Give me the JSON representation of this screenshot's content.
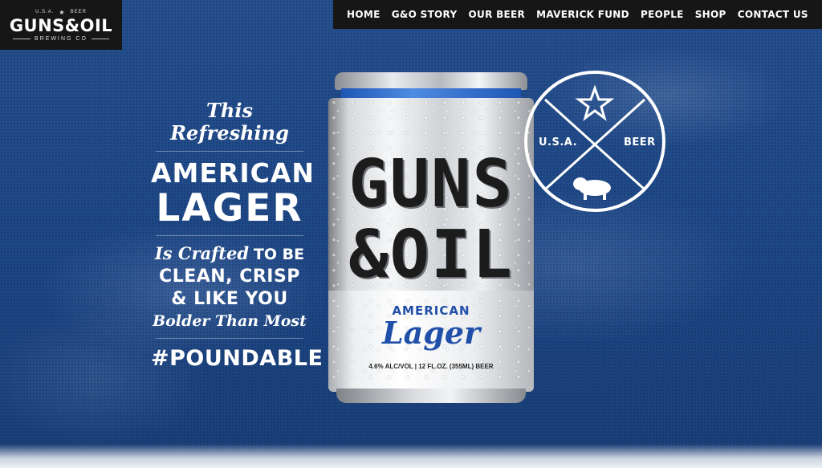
{
  "brand": {
    "mini_left": "U.S.A.",
    "mini_right": "BEER",
    "name": "GUNS&OIL",
    "tagline": "BREWING CO"
  },
  "nav": {
    "items": [
      {
        "label": "HOME"
      },
      {
        "label": "G&O STORY"
      },
      {
        "label": "OUR BEER"
      },
      {
        "label": "MAVERICK FUND"
      },
      {
        "label": "PEOPLE"
      },
      {
        "label": "SHOP"
      },
      {
        "label": "CONTACT US"
      }
    ]
  },
  "hero": {
    "line1": "This Refreshing",
    "line2": "AMERICAN",
    "line3": "LAGER",
    "line4_script": "Is Crafted",
    "line4_caps": "TO BE",
    "line5": "CLEAN, CRISP",
    "line6": "& LIKE YOU",
    "line7": "Bolder Than Most",
    "hashtag": "#POUNDABLE"
  },
  "can": {
    "brand_line1": "GUNS",
    "brand_line2": "&OIL",
    "style": "AMERICAN",
    "style_script": "Lager",
    "abv": "4.6% ALC/VOL  |  12 FL.OZ. (355ML) BEER"
  },
  "badge": {
    "left": "U.S.A.",
    "right": "BEER"
  },
  "colors": {
    "background": "#1f4a8a",
    "nav_bg": "#161616",
    "can_blue": "#1f4fa8"
  }
}
